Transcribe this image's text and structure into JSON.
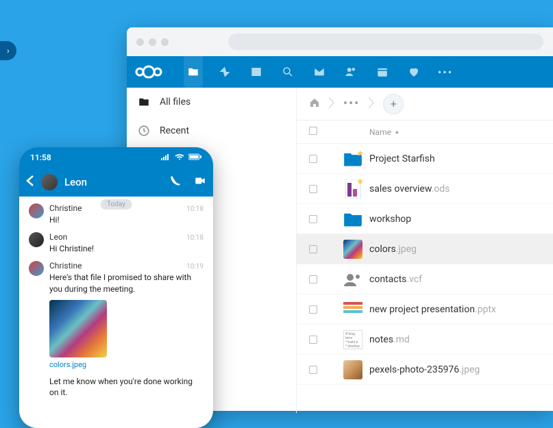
{
  "pill": {
    "chevron": "›"
  },
  "browser": {
    "sidebar": {
      "items": [
        {
          "icon": "folder-icon",
          "label": "All files"
        },
        {
          "icon": "clock-icon",
          "label": "Recent"
        }
      ]
    },
    "breadcrumb": {
      "home_icon": "home-icon",
      "more": "•••",
      "add_label": "+"
    },
    "list": {
      "header": {
        "name": "Name",
        "sort_dir": "▴"
      },
      "rows": [
        {
          "type": "folder",
          "starred": true,
          "name": "Project Starfish",
          "ext": ""
        },
        {
          "type": "ods",
          "starred": true,
          "name": "sales overview",
          "ext": ".ods"
        },
        {
          "type": "folder",
          "starred": false,
          "name": "workshop",
          "ext": ""
        },
        {
          "type": "image",
          "starred": false,
          "name": "colors",
          "ext": ".jpeg",
          "selected": true
        },
        {
          "type": "vcf",
          "starred": false,
          "name": "contacts",
          "ext": ".vcf"
        },
        {
          "type": "pptx",
          "starred": false,
          "name": "new project presentation",
          "ext": ".pptx"
        },
        {
          "type": "md",
          "starred": false,
          "name": "notes",
          "ext": ".md"
        },
        {
          "type": "image2",
          "starred": false,
          "name": "pexels-photo-235976",
          "ext": ".jpeg"
        }
      ]
    },
    "apps": [
      "files",
      "activity",
      "gallery",
      "search",
      "mail",
      "contacts",
      "calendar",
      "favorite",
      "more"
    ]
  },
  "phone": {
    "status": {
      "time": "11:58"
    },
    "nav": {
      "title": "Leon"
    },
    "day_chip": "Today",
    "messages": [
      {
        "sender": "Christine",
        "time": "10:18",
        "text": "Hi!"
      },
      {
        "sender": "Leon",
        "time": "10:18",
        "text": "Hi Christine!"
      },
      {
        "sender": "Christine",
        "time": "10:19",
        "text": "Here's that file I promised to share with you during the meeting."
      },
      {
        "attachment_label": "colors.jpeg"
      },
      {
        "followup": "Let me know when you're done working on it."
      }
    ]
  }
}
